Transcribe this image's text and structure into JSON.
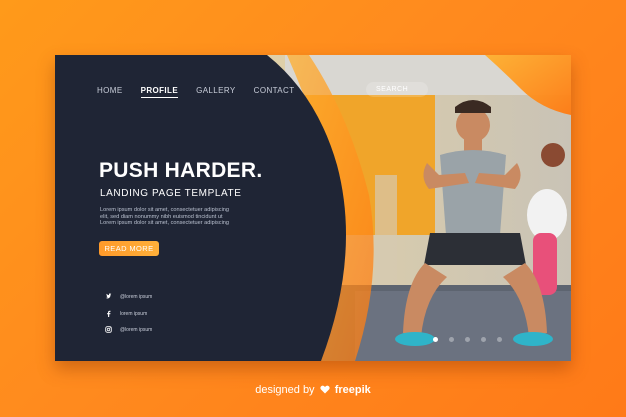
{
  "nav": {
    "items": [
      "HOME",
      "PROFILE",
      "GALLERY",
      "CONTACT"
    ],
    "active": "PROFILE"
  },
  "search": {
    "placeholder": "SEARCH"
  },
  "hero": {
    "title": "PUSH HARDER.",
    "subtitle": "LANDING PAGE TEMPLATE",
    "body": [
      "Lorem ipsum dolor sit amet, consectetuer adipiscing",
      "elit, sed diam nonummy nibh euismod tincidunt ut",
      "Lorem ipsum dolor sit amet, consectetuer adipiscing"
    ],
    "button": "READ MORE"
  },
  "social": [
    {
      "icon": "twitter-icon",
      "label": "@lorem ipsum"
    },
    {
      "icon": "facebook-icon",
      "label": "lorem ipsum"
    },
    {
      "icon": "instagram-icon",
      "label": "@lorem ipsum"
    }
  ],
  "slider": {
    "count": 5,
    "active_index": 0
  },
  "footer": {
    "prefix": "designed by",
    "brand": "freepik"
  },
  "colors": {
    "accent": "#ff9a2a",
    "panel": "#1f2535",
    "background": "#ff8a1e"
  }
}
